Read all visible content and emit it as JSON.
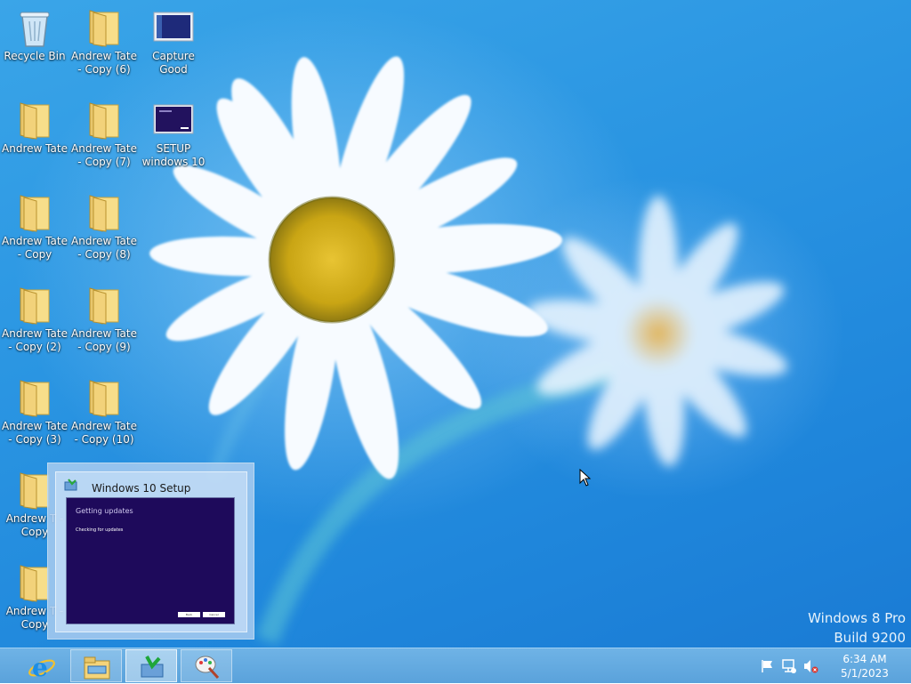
{
  "desktop": {
    "icons": [
      {
        "label": "Recycle Bin",
        "icon": "recycle-bin-icon"
      },
      {
        "label": "Andrew Tate - Copy (6)",
        "icon": "folder-icon"
      },
      {
        "label": "Capture Good",
        "icon": "image-thumbnail-icon"
      },
      {
        "label": "Andrew Tate",
        "icon": "folder-icon"
      },
      {
        "label": "Andrew Tate - Copy (7)",
        "icon": "folder-icon"
      },
      {
        "label": "SETUP windows 10",
        "icon": "image-thumbnail-icon"
      },
      {
        "label": "Andrew Tate - Copy",
        "icon": "folder-icon"
      },
      {
        "label": "Andrew Tate - Copy (8)",
        "icon": "folder-icon"
      },
      {
        "label": "Andrew Tate - Copy (2)",
        "icon": "folder-icon"
      },
      {
        "label": "Andrew Tate - Copy (9)",
        "icon": "folder-icon"
      },
      {
        "label": "Andrew Tate - Copy (3)",
        "icon": "folder-icon"
      },
      {
        "label": "Andrew Tate - Copy (10)",
        "icon": "folder-icon"
      },
      {
        "label": "Andrew T - Copy",
        "icon": "folder-icon"
      },
      {
        "label": "Andrew T - Copy",
        "icon": "folder-icon"
      }
    ]
  },
  "preview": {
    "title": "Windows 10 Setup",
    "screen_heading": "Getting updates",
    "screen_status": "Checking for updates",
    "screen_buttons": [
      "Back",
      "Cancel"
    ]
  },
  "watermark": {
    "line1": "Windows 8 Pro",
    "line2": "Build 9200"
  },
  "taskbar": {
    "buttons": [
      {
        "name": "internet-explorer-button",
        "icon": "internet-explorer-icon",
        "active": false
      },
      {
        "name": "file-explorer-button",
        "icon": "file-explorer-icon",
        "active": false
      },
      {
        "name": "windows-10-setup-button",
        "icon": "setup-icon",
        "active": true
      },
      {
        "name": "paint-button",
        "icon": "paint-icon",
        "active": false
      }
    ],
    "tray": {
      "icons": [
        "action-center-flag-icon",
        "network-icon",
        "volume-muted-icon"
      ],
      "time": "6:34 AM",
      "date": "5/1/2023"
    }
  },
  "colors": {
    "wallpaper": "#2a95e2",
    "taskbar": "#5aa2db",
    "setup_screen": "#1e0a5b"
  }
}
